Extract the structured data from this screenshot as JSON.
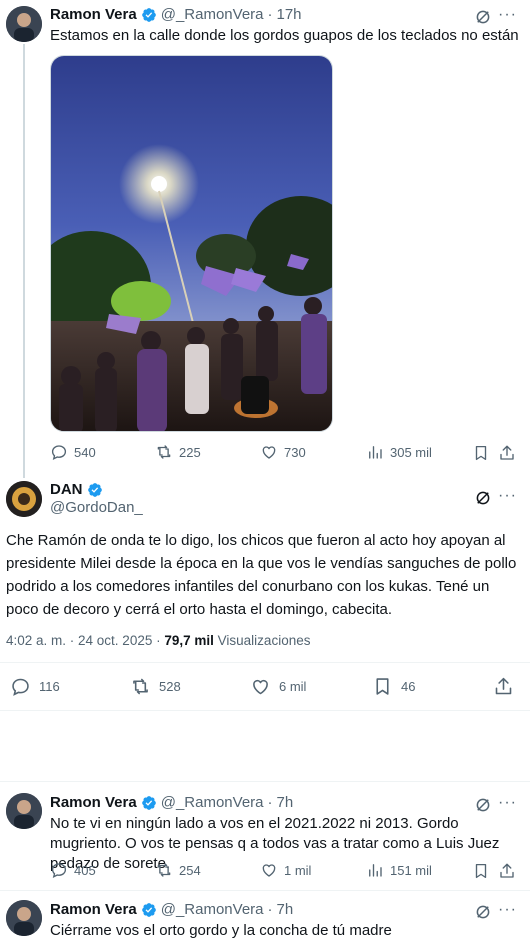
{
  "tweet1": {
    "name": "Ramon Vera",
    "handle": "@_RamonVera",
    "time": "17h",
    "text": "Estamos en la calle donde los gordos guapos de los teclados no están",
    "replies": "540",
    "retweets": "225",
    "likes": "730",
    "views": "305 mil"
  },
  "main_tweet": {
    "name": "DAN",
    "handle": "@GordoDan_",
    "text": "Che Ramón de onda te lo digo, los chicos que fueron al acto hoy apoyan al presidente Milei desde la época en la que vos le vendías sanguches de pollo podrido a los comedores infantiles del conurbano con los kukas. Tené un poco de decoro y cerrá el orto hasta el domingo, cabecita.",
    "timestamp": "4:02 a. m. · 24 oct. 2025 ·",
    "views_count": "79,7 mil",
    "views_label": "Visualizaciones",
    "replies": "116",
    "retweets": "528",
    "likes": "6 mil",
    "bookmarks": "46"
  },
  "reply1": {
    "name": "Ramon Vera",
    "handle": "@_RamonVera",
    "time": "7h",
    "text": "No te vi en ningún lado a vos en el 2021.2022 ni 2013. Gordo mugriento.  O vos te pensas q a todos vas a tratar como a Luis Juez pedazo de sorete.",
    "replies": "405",
    "retweets": "254",
    "likes": "1 mil",
    "views": "151 mil"
  },
  "reply2": {
    "name": "Ramon Vera",
    "handle": "@_RamonVera",
    "time": "7h",
    "text": "Ciérrame vos el orto gordo y la concha de tú madre"
  },
  "colors": {
    "text": "#0f1419",
    "muted": "#536471",
    "verified": "#1d9bf0",
    "divider": "#eff3f4"
  }
}
